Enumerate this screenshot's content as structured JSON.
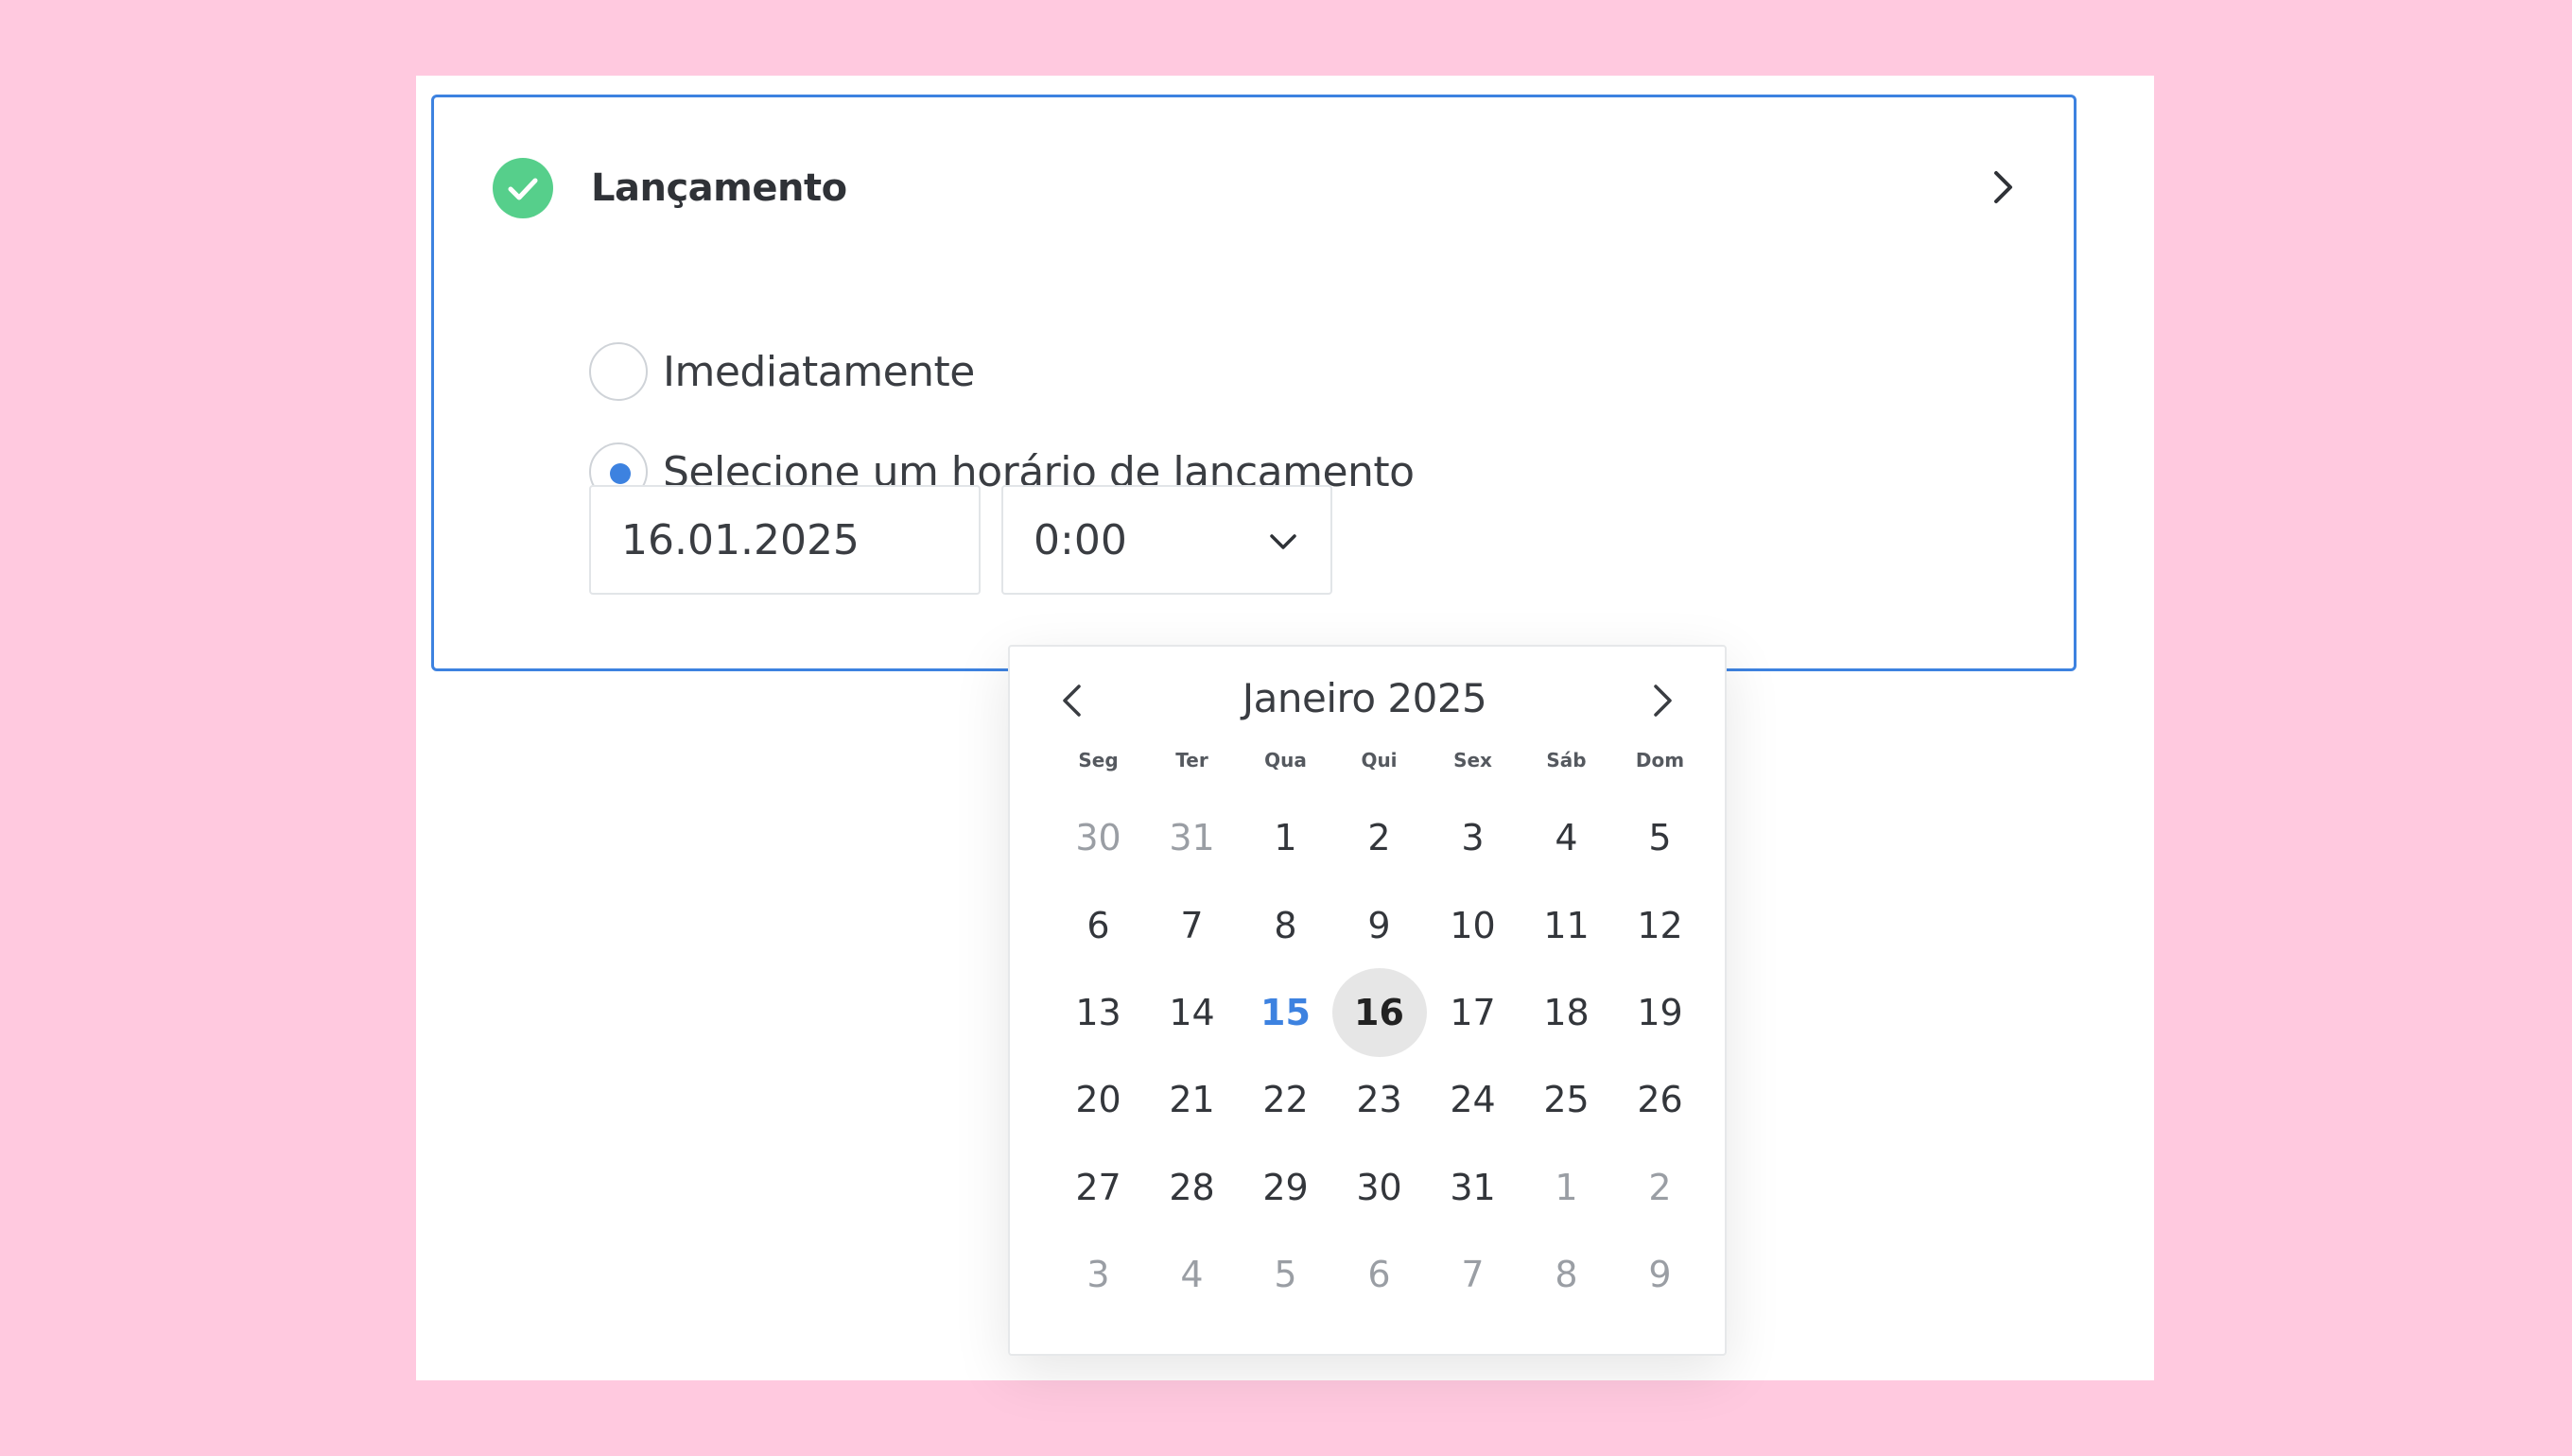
{
  "section": {
    "title": "Lançamento",
    "check_icon": "check-circle-icon",
    "expand_icon": "chevron-right-icon"
  },
  "colors": {
    "background": "#ffc9df",
    "accent": "#3d82e0",
    "success": "#56cf8b"
  },
  "options": [
    {
      "label": "Imediatamente",
      "selected": false
    },
    {
      "label": "Selecione um horário de lançamento",
      "selected": true
    }
  ],
  "date_field": {
    "value": "16.01.2025"
  },
  "time_field": {
    "value": "0:00",
    "icon": "chevron-down-icon"
  },
  "calendar": {
    "month_label": "Janeiro 2025",
    "weekdays": [
      "Seg",
      "Ter",
      "Qua",
      "Qui",
      "Sex",
      "Sáb",
      "Dom"
    ],
    "today": 15,
    "selected": 16,
    "days": [
      {
        "d": "30",
        "m": true
      },
      {
        "d": "31",
        "m": true
      },
      {
        "d": "1"
      },
      {
        "d": "2"
      },
      {
        "d": "3"
      },
      {
        "d": "4"
      },
      {
        "d": "5"
      },
      {
        "d": "6"
      },
      {
        "d": "7"
      },
      {
        "d": "8"
      },
      {
        "d": "9"
      },
      {
        "d": "10"
      },
      {
        "d": "11"
      },
      {
        "d": "12"
      },
      {
        "d": "13"
      },
      {
        "d": "14"
      },
      {
        "d": "15"
      },
      {
        "d": "16"
      },
      {
        "d": "17"
      },
      {
        "d": "18"
      },
      {
        "d": "19"
      },
      {
        "d": "20"
      },
      {
        "d": "21"
      },
      {
        "d": "22"
      },
      {
        "d": "23"
      },
      {
        "d": "24"
      },
      {
        "d": "25"
      },
      {
        "d": "26"
      },
      {
        "d": "27"
      },
      {
        "d": "28"
      },
      {
        "d": "29"
      },
      {
        "d": "30"
      },
      {
        "d": "31"
      },
      {
        "d": "1",
        "m": true
      },
      {
        "d": "2",
        "m": true
      },
      {
        "d": "3",
        "m": true
      },
      {
        "d": "4",
        "m": true
      },
      {
        "d": "5",
        "m": true
      },
      {
        "d": "6",
        "m": true
      },
      {
        "d": "7",
        "m": true
      },
      {
        "d": "8",
        "m": true
      },
      {
        "d": "9",
        "m": true
      }
    ]
  }
}
